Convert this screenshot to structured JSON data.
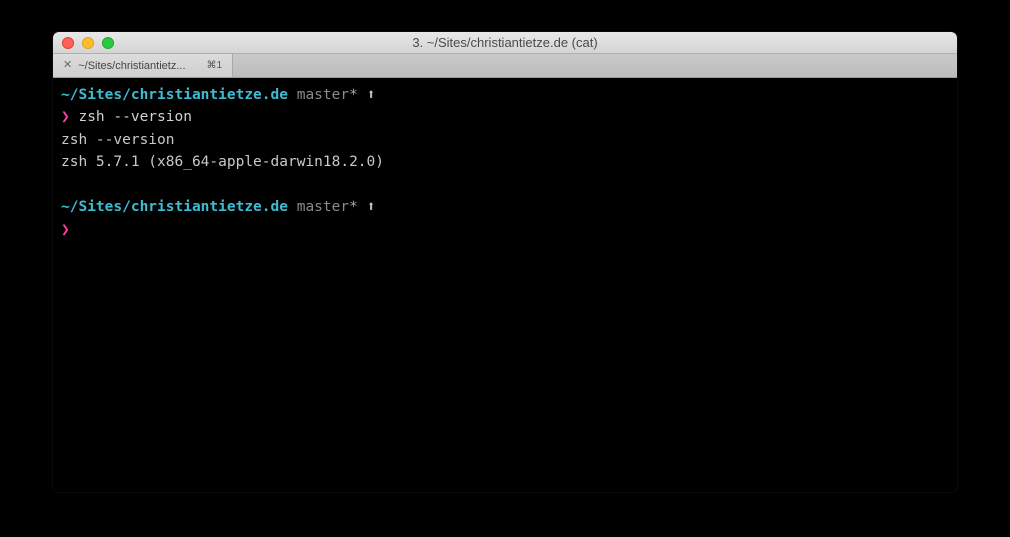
{
  "window": {
    "title": "3. ~/Sites/christiantietze.de (cat)"
  },
  "tab": {
    "label": "~/Sites/christiantietz...",
    "shortcut": "⌘1"
  },
  "prompt1": {
    "cwd": "~/Sites/christiantietze.de",
    "branch": "master",
    "dirty": "*",
    "ahead": "⬆",
    "chevron": "❯",
    "command": "zsh --version"
  },
  "output": {
    "echo": "zsh --version",
    "result": "zsh 5.7.1 (x86_64-apple-darwin18.2.0)"
  },
  "prompt2": {
    "cwd": "~/Sites/christiantietze.de",
    "branch": "master",
    "dirty": "*",
    "ahead": "⬆",
    "chevron": "❯"
  }
}
